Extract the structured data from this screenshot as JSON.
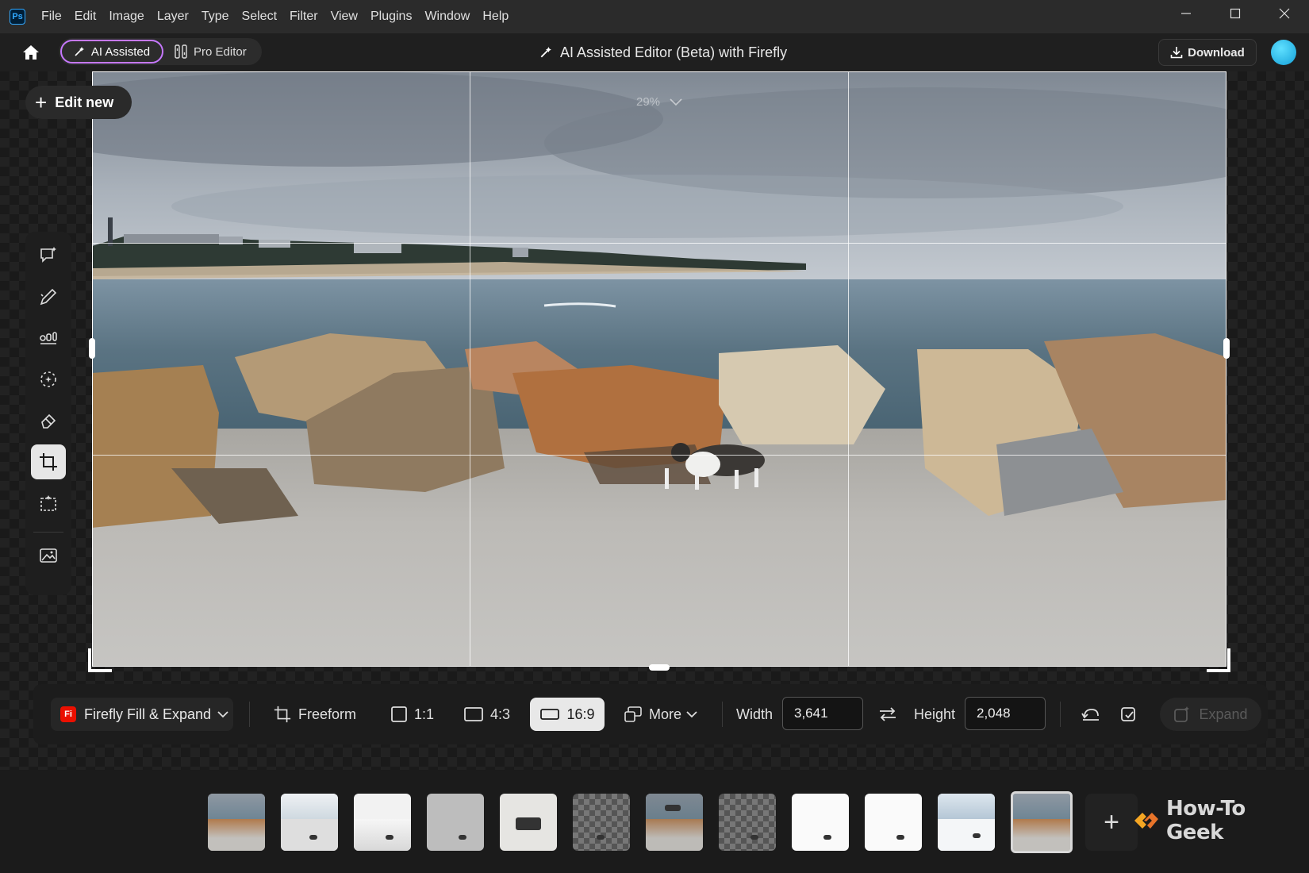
{
  "app": {
    "logo_text": "Ps",
    "menu": [
      "File",
      "Edit",
      "Image",
      "Layer",
      "Type",
      "Select",
      "Filter",
      "View",
      "Plugins",
      "Window",
      "Help"
    ]
  },
  "header": {
    "modes": {
      "ai": "AI Assisted",
      "pro": "Pro Editor"
    },
    "title": "AI Assisted Editor (Beta) with Firefly",
    "download_label": "Download"
  },
  "canvas": {
    "edit_new_label": "Edit new",
    "zoom": "29%"
  },
  "tools": [
    "chat-spark-icon",
    "brush-spark-icon",
    "adjust-sliders-icon",
    "select-spark-icon",
    "remove-object-icon",
    "crop-icon",
    "generate-fill-icon",
    "image-generate-icon"
  ],
  "crop_toolbar": {
    "feature_badge": "Fi",
    "feature_label": "Firefly Fill & Expand",
    "ratios": {
      "freeform": "Freeform",
      "square": "1:1",
      "four_three": "4:3",
      "sixteen_nine": "16:9",
      "more": "More"
    },
    "active_ratio": "16:9",
    "width_label": "Width",
    "width_value": "3,641",
    "height_label": "Height",
    "height_value": "2,048",
    "expand_label": "Expand"
  },
  "filmstrip": {
    "thumbnails": [
      {
        "style": "beach-photo"
      },
      {
        "style": "pale-sky"
      },
      {
        "style": "white-fog"
      },
      {
        "style": "grey-flat"
      },
      {
        "style": "cat-closeup"
      },
      {
        "style": "transparent"
      },
      {
        "style": "beach-cat"
      },
      {
        "style": "transparent"
      },
      {
        "style": "white"
      },
      {
        "style": "white"
      },
      {
        "style": "snow"
      },
      {
        "style": "beach-photo"
      }
    ],
    "active_index": 11
  },
  "watermark": "How-To Geek",
  "colors": {
    "ai_mode_border": "#c678ff",
    "firefly_red": "#eb1000",
    "avatar": "#14a0d8"
  }
}
